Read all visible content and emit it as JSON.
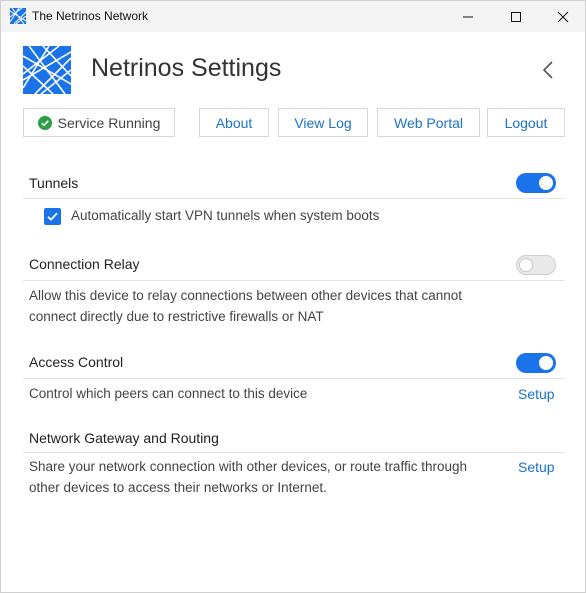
{
  "window": {
    "title": "The Netrinos Network"
  },
  "header": {
    "title": "Netrinos Settings"
  },
  "toolbar": {
    "status_label": "Service Running",
    "about_label": "About",
    "view_log_label": "View Log",
    "web_portal_label": "Web Portal",
    "logout_label": "Logout"
  },
  "sections": {
    "tunnels": {
      "title": "Tunnels",
      "enabled": true,
      "autostart_label": "Automatically start VPN tunnels when system boots",
      "autostart_checked": true
    },
    "relay": {
      "title": "Connection Relay",
      "enabled": false,
      "description_line1": "Allow this device to relay connections between other devices that cannot",
      "description_line2": "connect directly due to restrictive firewalls or NAT"
    },
    "access": {
      "title": "Access Control",
      "enabled": true,
      "description": "Control which peers can connect to this device",
      "setup_label": "Setup"
    },
    "gateway": {
      "title": "Network Gateway and Routing",
      "description_line1": "Share your network connection with other devices, or route traffic through",
      "description_line2": "other devices to access their networks or Internet.",
      "setup_label": "Setup"
    }
  },
  "colors": {
    "accent": "#1a73e8",
    "link": "#1a73c8",
    "status_ok": "#2e9e46"
  },
  "icons": {
    "app": "netrinos-logo-icon",
    "status": "check-circle-icon",
    "back": "chevron-left-icon"
  }
}
